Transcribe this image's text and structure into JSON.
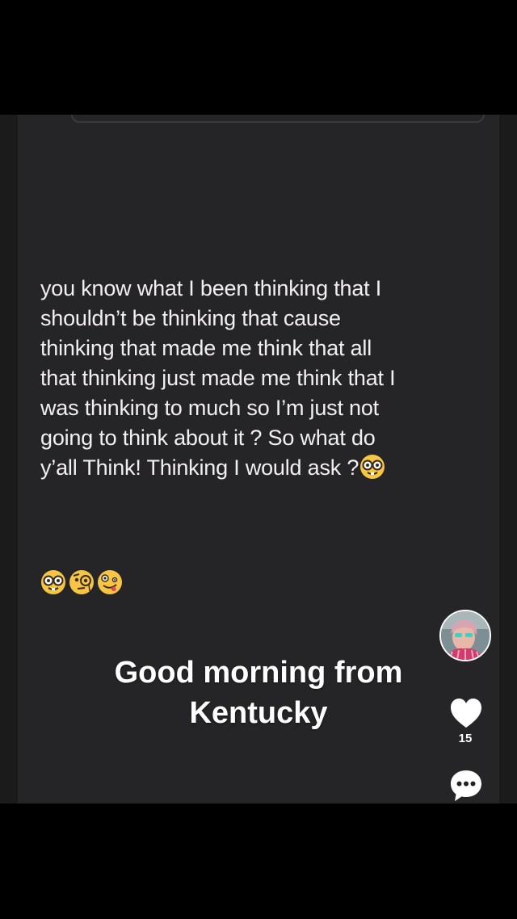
{
  "post": {
    "text": "you know what  I been thinking that I\nshouldn’t  be thinking that  cause\nthinking that made me think that all\nthat thinking just made me think that I\nwas thinking to much so I’m just not\ngoing to think about it ?  So what do\ny’all Think!   Thinking I would ask ?",
    "trailing_emojis": [
      "nerd-face",
      "nerd-face",
      "face-with-monocle",
      "zany-face"
    ]
  },
  "caption": {
    "text": "Good morning from\nKentucky"
  },
  "rail": {
    "like_count": "15"
  },
  "colors": {
    "frame_bg": "#252527",
    "text": "#f3eef2",
    "emoji_yellow": "#f7c544"
  }
}
